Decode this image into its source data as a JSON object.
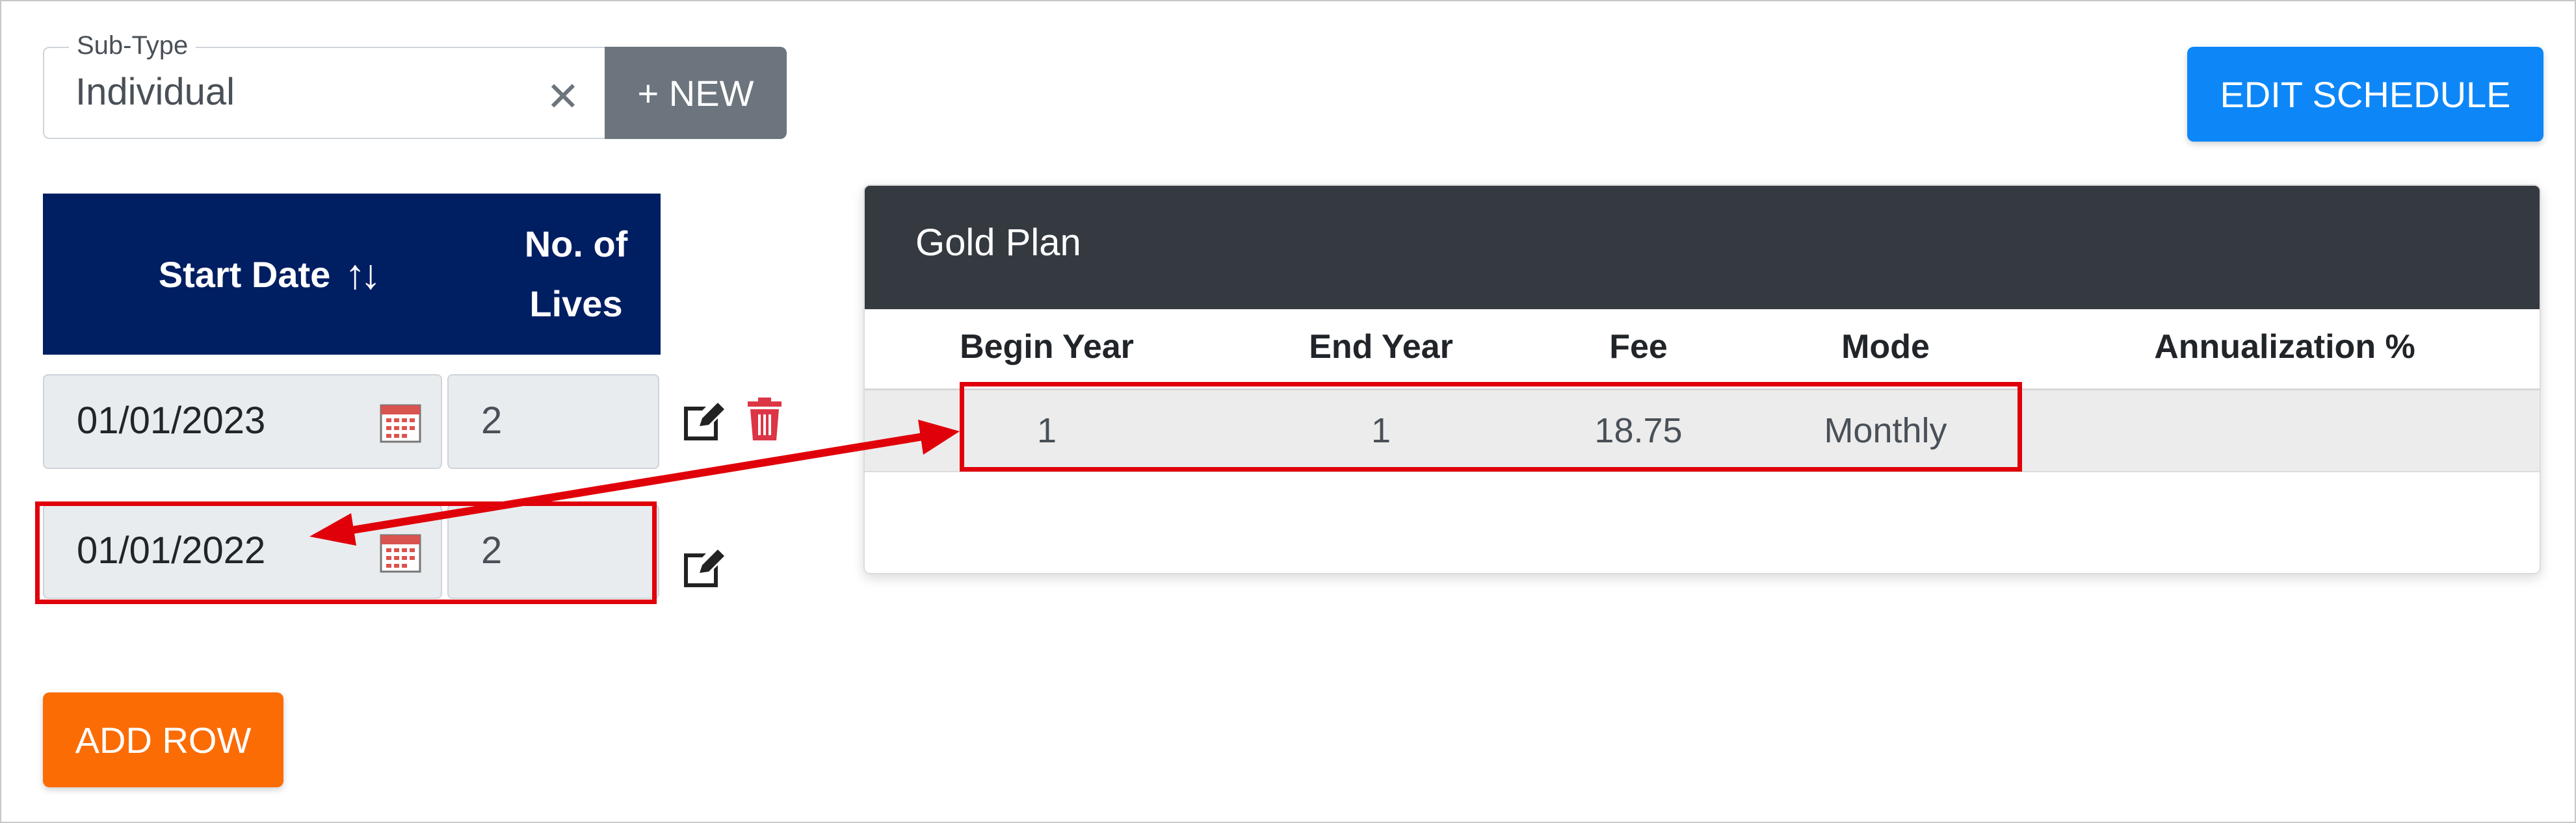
{
  "subtype": {
    "legend": "Sub-Type",
    "value": "Individual",
    "clear_glyph": "✕"
  },
  "buttons": {
    "new": "+ NEW",
    "edit_schedule": "EDIT SCHEDULE",
    "add_row": "ADD ROW"
  },
  "left_table": {
    "headers": {
      "start_date": "Start Date",
      "sort_glyph": "↑↓",
      "lives_line1": "No. of",
      "lives_line2": "Lives"
    },
    "rows": [
      {
        "start_date": "01/01/2023",
        "lives": "2",
        "icons": [
          "edit-icon",
          "trash-icon"
        ]
      },
      {
        "start_date": "01/01/2022",
        "lives": "2",
        "icons": [
          "edit-icon"
        ]
      }
    ]
  },
  "plan_card": {
    "title": "Gold Plan",
    "columns": [
      "Begin Year",
      "End Year",
      "Fee",
      "Mode",
      "Annualization %"
    ],
    "rows": [
      {
        "begin_year": "1",
        "end_year": "1",
        "fee": "18.75",
        "mode": "Monthly",
        "annualization": ""
      }
    ]
  },
  "colors": {
    "header_navy": "#001e62",
    "card_header": "#343a40",
    "edit_schedule_blue": "#0d87f8",
    "add_row_orange": "#fb6c05",
    "new_gray": "#6c757d",
    "annotation_red": "#e0000a",
    "trash_red": "#dc3545"
  }
}
